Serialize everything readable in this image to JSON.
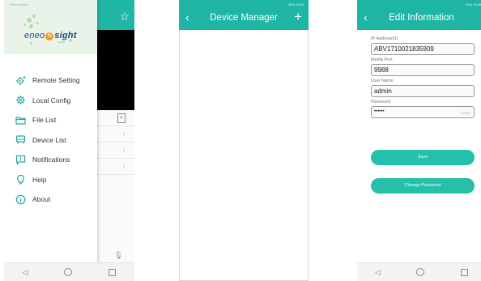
{
  "colors": {
    "accent": "#1fb5a4",
    "icon": "#20a89a",
    "logo_orange": "#f39c12"
  },
  "phone1": {
    "status_left": "China Mobile",
    "status_right": "59% 10:57",
    "logo": {
      "part1": "eneo",
      "mark": "N",
      "part2": "sight",
      "sub": "mobile"
    },
    "menu": [
      {
        "label": "Remote Setting",
        "icon": "gear-plus-icon"
      },
      {
        "label": "Local Config",
        "icon": "gear-icon"
      },
      {
        "label": "File List",
        "icon": "folder-icon"
      },
      {
        "label": "Device List",
        "icon": "device-icon"
      },
      {
        "label": "Notifications",
        "icon": "alert-icon"
      },
      {
        "label": "Help",
        "icon": "lightbulb-icon"
      },
      {
        "label": "About",
        "icon": "info-icon"
      }
    ]
  },
  "phone2": {
    "status_center": "",
    "status_right": "90% 11:34",
    "title": "Device Manager"
  },
  "phone3": {
    "status_right": "91% 10:55",
    "title": "Edit Information",
    "fields": [
      {
        "label": "IP Address/ID",
        "value": "ABV1710021835909"
      },
      {
        "label": "Media Port",
        "value": "9988"
      },
      {
        "label": "User Name",
        "value": "admin"
      },
      {
        "label": "Password",
        "value": "••••••"
      }
    ],
    "save_label": "Save",
    "change_password_label": "Change Password"
  }
}
